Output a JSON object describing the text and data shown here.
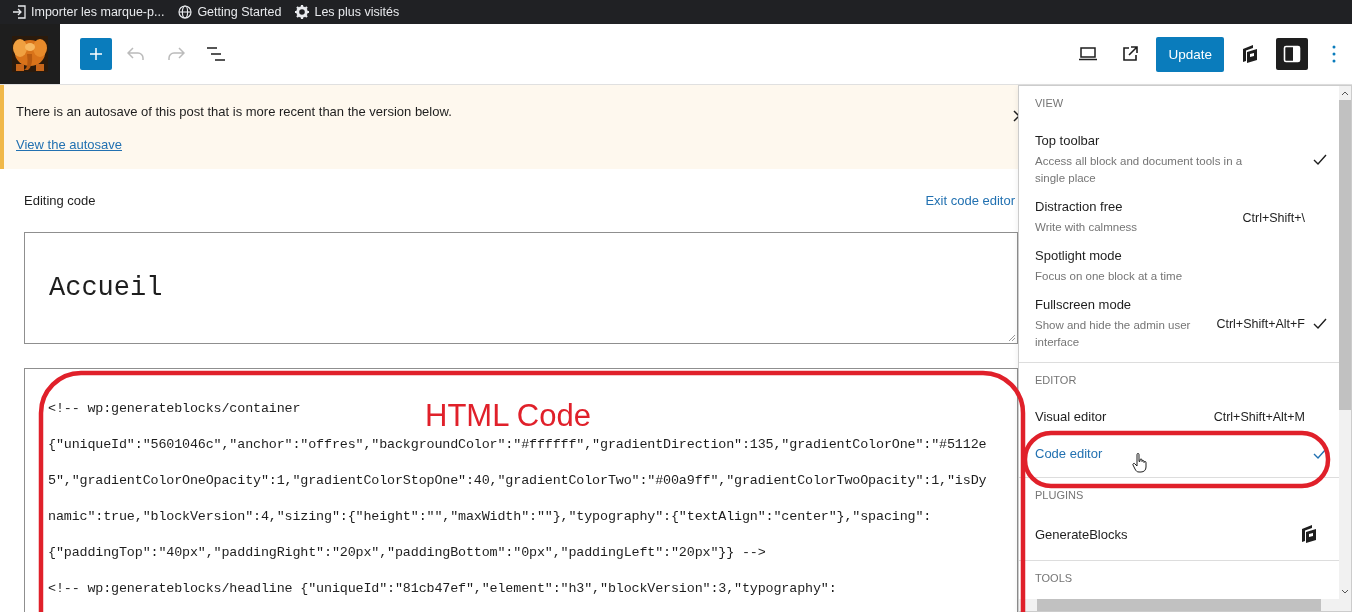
{
  "bookmarks": [
    {
      "kind": "import",
      "label": "Importer les marque-p..."
    },
    {
      "kind": "globe",
      "label": "Getting Started"
    },
    {
      "kind": "gear",
      "label": "Les plus visités"
    }
  ],
  "toolbar_left": [
    {
      "kind": "add",
      "disabled": false
    },
    {
      "kind": "undo",
      "disabled": true
    },
    {
      "kind": "redo",
      "disabled": true
    },
    {
      "kind": "list-view",
      "disabled": false
    }
  ],
  "toolbar_right": [
    {
      "kind": "preview"
    },
    {
      "kind": "view-post"
    },
    {
      "kind": "update",
      "label": "Update"
    },
    {
      "kind": "generateblocks"
    },
    {
      "kind": "options"
    }
  ],
  "settings_toggle": {
    "pressed": true
  },
  "notice": {
    "text": "There is an autosave of this post that is more recent than the version below.",
    "link": "View the autosave"
  },
  "editor": {
    "heading": "Editing code",
    "exit": "Exit code editor",
    "title": "Accueil",
    "code_lines": [
      "<!-- wp:generateblocks/container",
      "{\"uniqueId\":\"5601046c\",\"anchor\":\"offres\",\"backgroundColor\":\"#ffffff\",\"gradientDirection\":135,\"gradientColorOne\":\"#5112e",
      "5\",\"gradientColorOneOpacity\":1,\"gradientColorStopOne\":40,\"gradientColorTwo\":\"#00a9ff\",\"gradientColorTwoOpacity\":1,\"isDy",
      "namic\":true,\"blockVersion\":4,\"sizing\":{\"height\":\"\",\"maxWidth\":\"\"},\"typography\":{\"textAlign\":\"center\"},\"spacing\":",
      "{\"paddingTop\":\"40px\",\"paddingRight\":\"20px\",\"paddingBottom\":\"0px\",\"paddingLeft\":\"20px\"}} -->",
      "<!-- wp:generateblocks/headline {\"uniqueId\":\"81cb47ef\",\"element\":\"h3\",\"blockVersion\":3,\"typography\":"
    ]
  },
  "menu": {
    "sections": [
      {
        "heading": "VIEW",
        "items": [
          {
            "kind": "option",
            "label": "Top toolbar",
            "description": "Access all block and document tools in a single place",
            "checked": true,
            "selected": false,
            "hovered": false
          },
          {
            "kind": "option",
            "label": "Distraction free",
            "description": "Write with calmness",
            "shortcut": "Ctrl+Shift+\\",
            "checked": false,
            "selected": false,
            "hovered": false
          },
          {
            "kind": "option",
            "label": "Spotlight mode",
            "description": "Focus on one block at a time",
            "checked": false,
            "selected": false,
            "hovered": false
          },
          {
            "kind": "option",
            "label": "Fullscreen mode",
            "description": "Show and hide the admin user interface",
            "shortcut": "Ctrl+Shift+Alt+F",
            "checked": true,
            "selected": false,
            "hovered": false
          }
        ]
      },
      {
        "heading": "EDITOR",
        "items": [
          {
            "kind": "option",
            "label": "Visual editor",
            "shortcut": "Ctrl+Shift+Alt+M",
            "checked": false,
            "selected": false,
            "hovered": false
          },
          {
            "kind": "option",
            "label": "Code editor",
            "checked": true,
            "selected": true,
            "hovered": true
          }
        ]
      },
      {
        "heading": "PLUGINS",
        "items": [
          {
            "kind": "plugin",
            "label": "GenerateBlocks",
            "checked": false,
            "selected": false,
            "hovered": false
          }
        ]
      },
      {
        "heading": "TOOLS"
      }
    ]
  },
  "annotations": [
    {
      "kind": "code-outline"
    },
    {
      "kind": "menu-outline"
    },
    {
      "kind": "label",
      "text": "HTML Code"
    }
  ]
}
